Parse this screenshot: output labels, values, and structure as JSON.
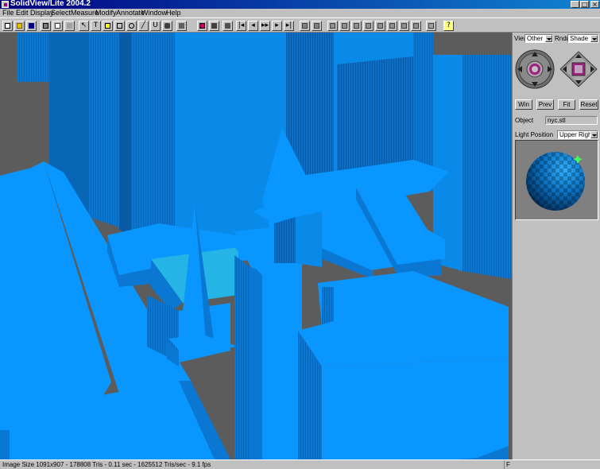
{
  "window": {
    "title": "SolidView/Lite 2004.2",
    "minimize_glyph": "_",
    "maximize_glyph": "□",
    "close_glyph": "×"
  },
  "menu": [
    "File",
    "Edit",
    "Display",
    "Select",
    "Measure",
    "Modify",
    "Annotate",
    "Window",
    "Help"
  ],
  "toolbar": {
    "text_tool": "T",
    "help_tool": "?",
    "icons": [
      "new-icon",
      "open-icon",
      "save-icon",
      "print-icon",
      "copy-icon",
      "paste-icon",
      "select-arrow-icon",
      "text-icon",
      "note-icon",
      "rectangle-icon",
      "ellipse-icon",
      "line-icon",
      "lasso-icon",
      "hand-icon",
      "film-icon",
      "camera-icon",
      "view-icon",
      "first-frame-icon",
      "prev-frame-icon",
      "play-icon",
      "next-frame-icon",
      "last-frame-icon",
      "cube-icon",
      "help-icon"
    ]
  },
  "panel": {
    "view_label": "View",
    "view_value": "Other",
    "rndr_label": "Rndr",
    "rndr_value": "Shade",
    "buttons": {
      "win": "Win",
      "prev": "Prev",
      "fit": "Fit",
      "reset": "Reset"
    },
    "object_label": "Object",
    "object_value": "nyc.stl",
    "light_label": "Light Position",
    "light_value": "Upper Right"
  },
  "status": {
    "text": "Image Size 1091x907 - 178808 Tris - 0.11 sec - 1625512 Tris/sec - 9.1 fps",
    "flag": "F"
  },
  "colors": {
    "building_top": "#0a96ff",
    "building_side": "#0a78d2",
    "building_dark": "#084e8c",
    "ground": "#5c5c5c",
    "titlebar": "#000080"
  }
}
